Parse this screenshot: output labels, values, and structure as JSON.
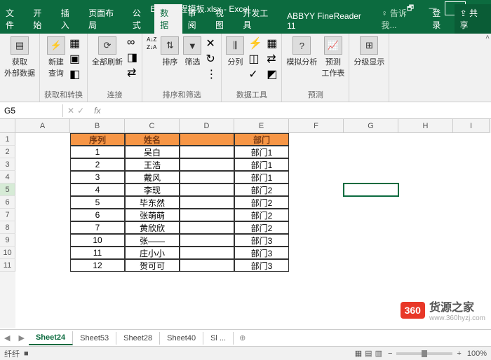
{
  "window": {
    "title": "Excel教程模板.xlsx - Excel",
    "restore_icon": "🗗",
    "min_icon": "—",
    "max_icon": "□",
    "close_icon": "✕"
  },
  "tabs": {
    "file": "文件",
    "home": "开始",
    "insert": "插入",
    "layout": "页面布局",
    "formula": "公式",
    "data": "数据",
    "review": "审阅",
    "view": "视图",
    "dev": "开发工具",
    "abbyy": "ABBYY FineReader 11",
    "tellme": "♀ 告诉我...",
    "signin": "登录",
    "share": "⇪ 共享"
  },
  "ribbon": {
    "g1": {
      "item1": "获取\n外部数据",
      "label": ""
    },
    "g2": {
      "item1": "新建\n查询",
      "label": "获取和转换"
    },
    "g3": {
      "item1": "全部刷新",
      "label": "连接"
    },
    "g4": {
      "az": "A↓Z",
      "za": "Z↓A",
      "sort": "排序",
      "filter": "筛选",
      "label": "排序和筛选"
    },
    "g5": {
      "split": "分列",
      "label": "数据工具"
    },
    "g6": {
      "whatif": "模拟分析",
      "forecast": "预测\n工作表",
      "label": "预测"
    },
    "g7": {
      "outline": "分级显示",
      "label": ""
    }
  },
  "namebox": "G5",
  "fx": "fx",
  "headers": {
    "b": "序列",
    "c": "姓名",
    "d": "",
    "e": "部门"
  },
  "colLetters": [
    "A",
    "B",
    "C",
    "D",
    "E",
    "F",
    "G",
    "H",
    "I"
  ],
  "rowNums": [
    "1",
    "2",
    "3",
    "4",
    "5",
    "6",
    "7",
    "8",
    "9",
    "10",
    "11"
  ],
  "rows": [
    {
      "b": "1",
      "c": "吴白",
      "e": "部门1"
    },
    {
      "b": "2",
      "c": "王浩",
      "e": "部门1"
    },
    {
      "b": "3",
      "c": "戴风",
      "e": "部门1"
    },
    {
      "b": "4",
      "c": "李现",
      "e": "部门2"
    },
    {
      "b": "5",
      "c": "毕东然",
      "e": "部门2"
    },
    {
      "b": "6",
      "c": "张萌萌",
      "e": "部门2"
    },
    {
      "b": "7",
      "c": "黄欣欣",
      "e": "部门2"
    },
    {
      "b": "10",
      "c": "张——",
      "e": "部门3"
    },
    {
      "b": "11",
      "c": "庄小小",
      "e": "部门3"
    },
    {
      "b": "12",
      "c": "贺可可",
      "e": "部门3"
    }
  ],
  "sheets": {
    "s1": "Sheet24",
    "s2": "Sheet53",
    "s3": "Sheet28",
    "s4": "Sheet40",
    "s5": "Sl ..."
  },
  "status": {
    "ready": "纤纤",
    "rec": "■",
    "zoom": "100%"
  },
  "watermark": {
    "badge": "360",
    "main": "货源之家",
    "sub": "www.360hyzj.com"
  },
  "cursor": "✥",
  "colW": {
    "A": 78,
    "B": 78,
    "C": 78,
    "D": 78,
    "E": 78,
    "F": 78,
    "G": 78,
    "H": 78,
    "I": 52
  }
}
